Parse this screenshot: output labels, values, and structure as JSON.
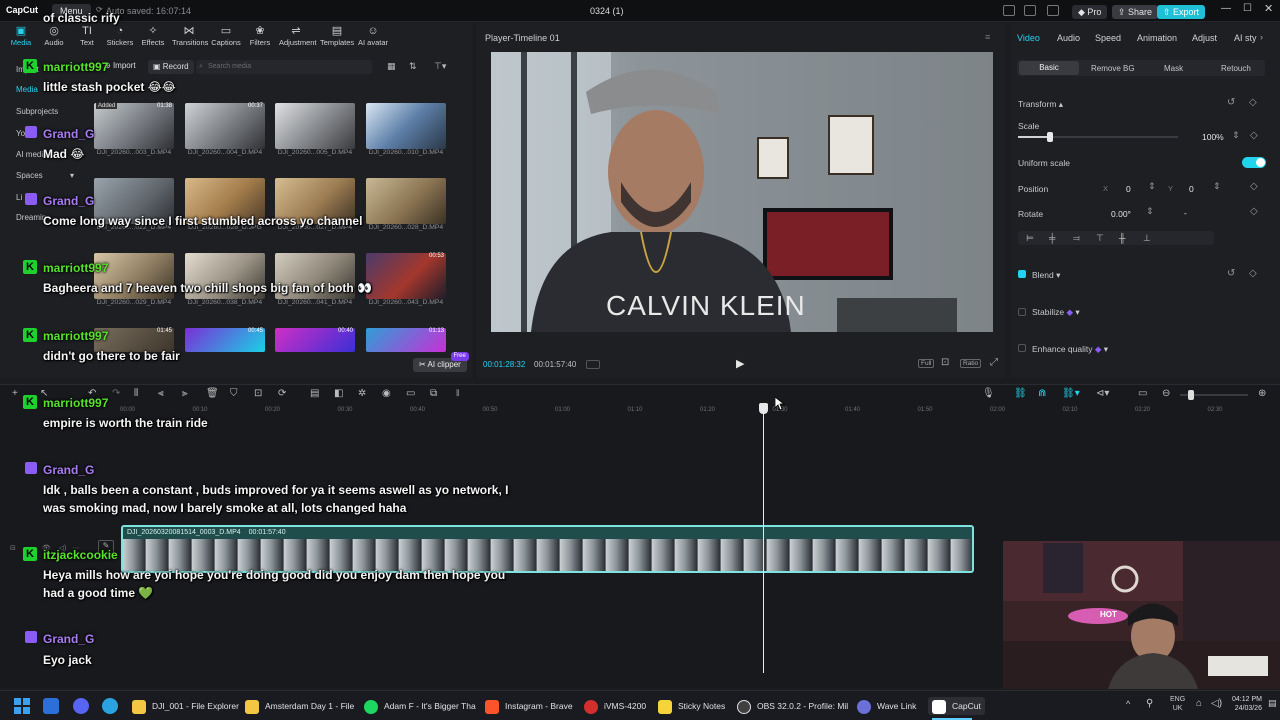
{
  "titlebar": {
    "app_logo": "CapCut",
    "menu_label": "Menu",
    "autosave_text": "Auto saved: 16:07:14",
    "project_title": "0324 (1)",
    "pro_label": "Pro",
    "share_label": "Share",
    "export_label": "Export"
  },
  "toolbar": {
    "tools": [
      {
        "label": "Media",
        "icon": "media-icon"
      },
      {
        "label": "Audio",
        "icon": "audio-icon"
      },
      {
        "label": "Text",
        "icon": "text-icon"
      },
      {
        "label": "Stickers",
        "icon": "sticker-icon"
      },
      {
        "label": "Effects",
        "icon": "effects-icon"
      },
      {
        "label": "Transitions",
        "icon": "transitions-icon"
      },
      {
        "label": "Captions",
        "icon": "captions-icon"
      },
      {
        "label": "Filters",
        "icon": "filters-icon"
      },
      {
        "label": "Adjustment",
        "icon": "adjustment-icon"
      },
      {
        "label": "Templates",
        "icon": "templates-icon"
      },
      {
        "label": "AI avatar",
        "icon": "ai-avatar-icon"
      }
    ]
  },
  "sidebar": {
    "items": [
      {
        "label": "Import"
      },
      {
        "label": "Media"
      },
      {
        "label": "Subprojects"
      },
      {
        "label": "Yo"
      },
      {
        "label": "AI media"
      },
      {
        "label": "Spaces"
      },
      {
        "label": "Li"
      },
      {
        "label": "Dreamin"
      }
    ]
  },
  "media": {
    "import_label": "Import",
    "record_label": "Record",
    "search_placeholder": "Search media",
    "ai_clipper_label": "AI clipper",
    "ai_clipper_badge": "Free",
    "thumbnails": [
      {
        "name": "DJI_20260...003_D.MP4",
        "duration": "01:38",
        "added": "Added"
      },
      {
        "name": "DJI_20260...004_D.MP4",
        "duration": "00:37",
        "added": ""
      },
      {
        "name": "DJI_20260...005_D.MP4",
        "duration": "",
        "added": ""
      },
      {
        "name": "DJI_20260...010_D.MP4",
        "duration": "",
        "added": ""
      },
      {
        "name": "DJI_20260...022_D.MP4",
        "duration": "",
        "added": ""
      },
      {
        "name": "DJI_20260...026_D.JPG",
        "duration": "",
        "added": ""
      },
      {
        "name": "DJI_20260...027_D.MP4",
        "duration": "",
        "added": ""
      },
      {
        "name": "DJI_20260...028_D.MP4",
        "duration": "",
        "added": ""
      },
      {
        "name": "DJI_20260...029_D.MP4",
        "duration": "",
        "added": ""
      },
      {
        "name": "DJI_20260...038_D.MP4",
        "duration": "",
        "added": ""
      },
      {
        "name": "DJI_20260...041_D.MP4",
        "duration": "",
        "added": ""
      },
      {
        "name": "DJI_20260...043_D.MP4",
        "duration": "00:53",
        "added": ""
      },
      {
        "name": "",
        "duration": "01:45",
        "added": ""
      },
      {
        "name": "",
        "duration": "00:45",
        "added": ""
      },
      {
        "name": "",
        "duration": "00:40",
        "added": ""
      },
      {
        "name": "",
        "duration": "01:13",
        "added": ""
      }
    ]
  },
  "chat": [
    {
      "platform": "kick",
      "user": "",
      "message": "of classic rify"
    },
    {
      "platform": "kick",
      "user": "marriott997",
      "message": "little stash pocket 😂😂"
    },
    {
      "platform": "twitch",
      "user": "Grand_G",
      "message": "Mad 😂"
    },
    {
      "platform": "twitch",
      "user": "Grand_G",
      "message": "Come long way since I first stumbled across yo channel"
    },
    {
      "platform": "kick",
      "user": "marriott997",
      "message": "Bagheera and 7 heaven two chill shops big fan of both 👀"
    },
    {
      "platform": "kick",
      "user": "marriott997",
      "message": "didn't go there to be fair"
    },
    {
      "platform": "kick",
      "user": "marriott997",
      "message": "empire is worth the train ride"
    },
    {
      "platform": "twitch",
      "user": "Grand_G",
      "message": "Idk , balls been a constant , buds improved for ya it seems aswell as yo network, I was smoking mad, now I barely smoke at all, lots changed haha"
    },
    {
      "platform": "kick",
      "user": "itzjackcookie",
      "message": "Heya mills how are yoi hope you're doing good did you enjoy dam then hope you had a good time 💚"
    },
    {
      "platform": "twitch",
      "user": "Grand_G",
      "message": "Eyo jack"
    }
  ],
  "player": {
    "title": "Player-Timeline 01",
    "current_time": "00:01:28:32",
    "total_time": "00:01:57:40",
    "full_label": "Full",
    "ratio_label": "Ratio",
    "poster_text": "CALVIN KLEIN"
  },
  "inspector": {
    "tabs": [
      "Video",
      "Audio",
      "Speed",
      "Animation",
      "Adjust",
      "AI sty"
    ],
    "subtabs": [
      "Basic",
      "Remove BG",
      "Mask",
      "Retouch"
    ],
    "transform_label": "Transform",
    "scale_label": "Scale",
    "scale_value": "100%",
    "scale_fraction": 0.2,
    "uniform_scale_label": "Uniform scale",
    "position_label": "Position",
    "pos_x_label": "X",
    "pos_x": "0",
    "pos_y_label": "Y",
    "pos_y": "0",
    "rotate_label": "Rotate",
    "rotate_value": "0.00°",
    "rotate_dash": "-",
    "blend_label": "Blend",
    "stabilize_label": "Stabilize",
    "enhance_label": "Enhance quality"
  },
  "timeline": {
    "clip_name": "DJI_20260320081514_0003_D.MP4",
    "clip_duration": "00:01:57:40",
    "ticks": [
      "00:00",
      "00:10",
      "00:20",
      "00:30",
      "00:40",
      "00:50",
      "01:00",
      "01:10",
      "01:20",
      "01:30",
      "01:40",
      "01:50",
      "02:00",
      "02:10",
      "02:20",
      "02:30"
    ]
  },
  "webcam": {
    "sign_text": "HOT"
  },
  "taskbar": {
    "items": [
      {
        "label": "DJI_001 - File Explorer",
        "color": "#f3c744"
      },
      {
        "label": "Amsterdam Day 1 - File",
        "color": "#f3c744"
      },
      {
        "label": "Adam F - It's Bigger Tha",
        "color": "#1ed760"
      },
      {
        "label": "Instagram - Brave",
        "color": "#fb542b"
      },
      {
        "label": "iVMS-4200",
        "color": "#d32f2f"
      },
      {
        "label": "Sticky Notes",
        "color": "#f5d33b"
      },
      {
        "label": "OBS 32.0.2 - Profile: Mil",
        "color": "#404040"
      },
      {
        "label": "Wave Link",
        "color": "#6b6fd8"
      },
      {
        "label": "CapCut",
        "color": "#ffffff"
      }
    ],
    "lang": "ENG",
    "region": "UK",
    "time": "04:12 PM",
    "date": "24/03/26"
  },
  "colors": {
    "accent": "#22d3ee",
    "export": "#1fbfd6",
    "kick": "#57e32c",
    "twitch": "#a97cf2"
  }
}
